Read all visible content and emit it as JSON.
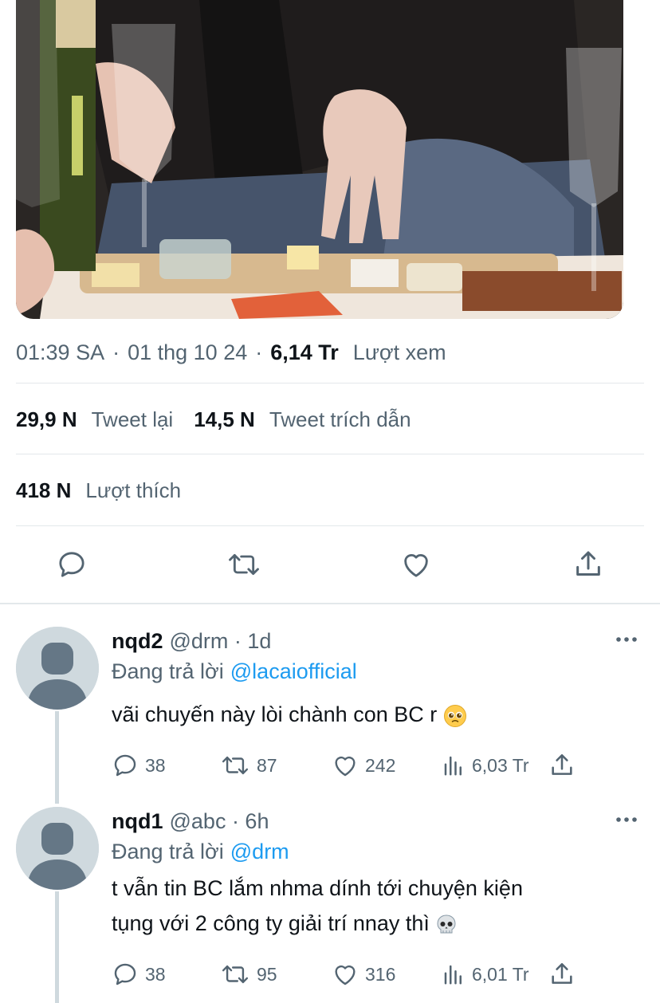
{
  "tweet": {
    "meta": {
      "time": "01:39 SA",
      "date": "01 thg 10 24",
      "views": "6,14 Tr",
      "views_label": "Lượt xem"
    },
    "stats": {
      "retweets": "29,9 N",
      "retweets_label": "Tweet lại",
      "quotes": "14,5 N",
      "quotes_label": "Tweet trích dẫn",
      "likes": "418 N",
      "likes_label": "Lượt thích"
    },
    "actions": [
      "reply-icon",
      "retweet-icon",
      "like-icon",
      "share-icon"
    ]
  },
  "replies": [
    {
      "name": "nqd2",
      "handle": "@drm · 1d",
      "replying_label": "Đang trả lời",
      "replying_to": "@lacaiofficial",
      "text": "vãi chuyến này lòi chành con BC r",
      "emoji": "pleading-face-emoji",
      "replies": "38",
      "retweets": "87",
      "likes": "242",
      "views": "6,03 Tr"
    },
    {
      "name": "nqd1",
      "handle": "@abc · 6h",
      "replying_label": "Đang trả lời",
      "replying_to": "@drm",
      "text_line1": "t vẫn tin BC lắm nhma dính tới chuyện kiện",
      "text_line2": "tụng với 2 công ty giải trí nnay thì",
      "emoji": "skull-emoji",
      "replies": "38",
      "retweets": "95",
      "likes": "316",
      "views": "6,01 Tr"
    }
  ],
  "colors": {
    "text": "#0f1419",
    "muted": "#536471",
    "link": "#1d9bf0",
    "divider": "#e3e8eb",
    "avatar": "#cfd9de"
  }
}
